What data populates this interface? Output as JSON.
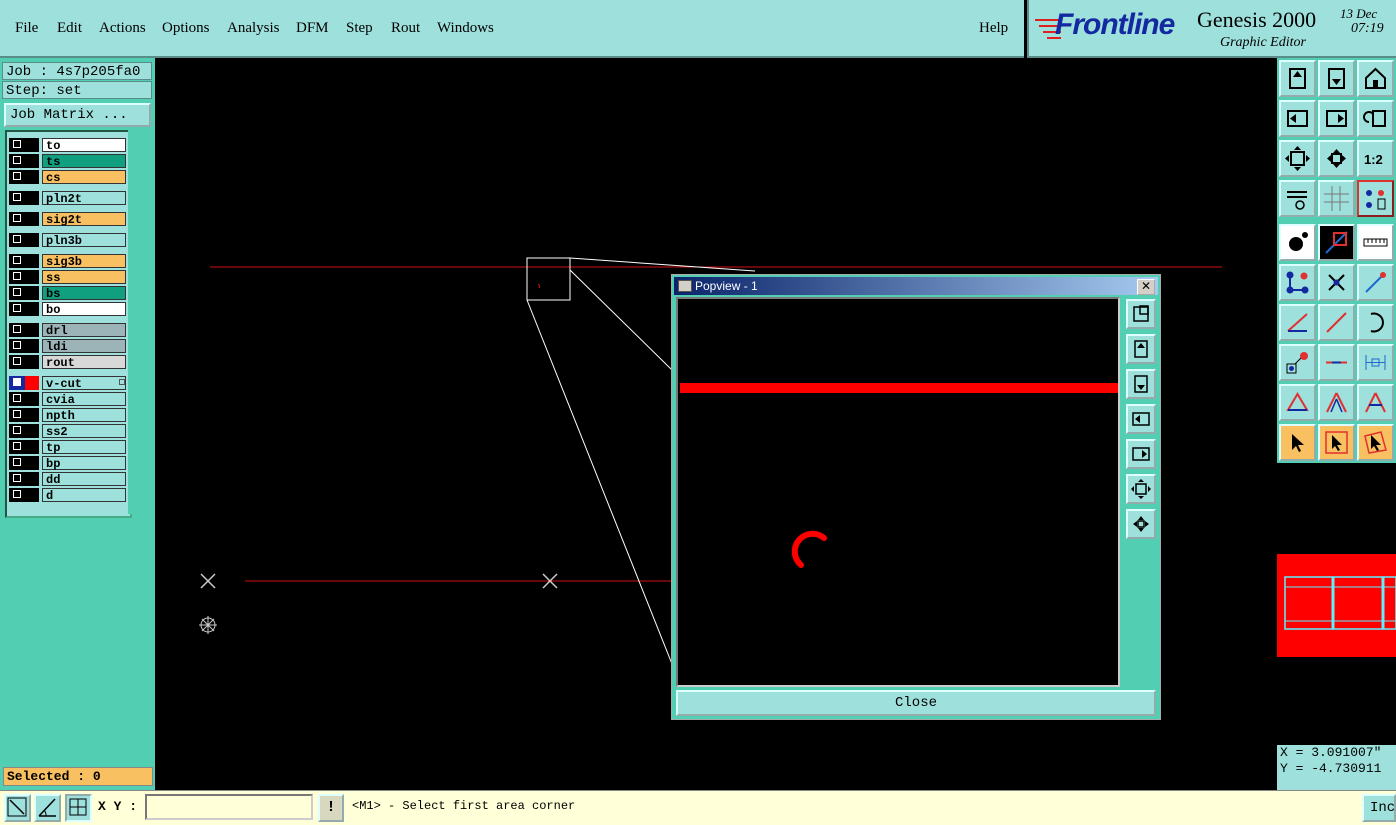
{
  "menu": {
    "items": [
      "File",
      "Edit",
      "Actions",
      "Options",
      "Analysis",
      "DFM",
      "Step",
      "Rout",
      "Windows"
    ],
    "help": "Help"
  },
  "brand": {
    "logo": "Frontline",
    "product": "Genesis 2000",
    "subtitle": "Graphic Editor",
    "date": "13 Dec",
    "time": "07:19"
  },
  "job": {
    "job_text": "Job : 4s7p205fa0",
    "step_text": "Step: set",
    "matrix_button": "Job Matrix ..."
  },
  "layers": [
    {
      "name": "to",
      "color": "#ffffff"
    },
    {
      "name": "ts",
      "color": "#10a080"
    },
    {
      "name": "cs",
      "color": "#f8c060"
    },
    {
      "name": "pln2t",
      "color": "#9ee0dc"
    },
    {
      "name": "sig2t",
      "color": "#f8c060"
    },
    {
      "name": "pln3b",
      "color": "#9ee0dc"
    },
    {
      "name": "sig3b",
      "color": "#f8c060"
    },
    {
      "name": "ss",
      "color": "#f8c060"
    },
    {
      "name": "bs",
      "color": "#10a080"
    },
    {
      "name": "bo",
      "color": "#ffffff"
    },
    {
      "name": "drl",
      "color": "#9cb4b8"
    },
    {
      "name": "ldi",
      "color": "#9cb4b8"
    },
    {
      "name": "rout",
      "color": "#d8d8d8"
    },
    {
      "name": "v-cut",
      "color": "#9ee0dc",
      "active": true
    },
    {
      "name": "cvia",
      "color": "#9ee0dc"
    },
    {
      "name": "npth",
      "color": "#9ee0dc"
    },
    {
      "name": "ss2",
      "color": "#9ee0dc"
    },
    {
      "name": "tp",
      "color": "#9ee0dc"
    },
    {
      "name": "bp",
      "color": "#9ee0dc"
    },
    {
      "name": "dd",
      "color": "#9ee0dc"
    },
    {
      "name": "d",
      "color": "#9ee0dc"
    }
  ],
  "selected_text": "Selected : 0",
  "popview": {
    "title": "Popview - 1",
    "close_label": "Close",
    "close_x": "✕"
  },
  "coords": {
    "x_text": "X = 3.091007\"",
    "y_text": "Y = -4.730911"
  },
  "statusbar": {
    "xy_label": "X Y :",
    "xy_value": "",
    "warn_symbol": "!",
    "message": "<M1> - Select first area corner",
    "right_button": "Inc"
  },
  "colors": {
    "teal": "#52cfb2",
    "light_teal": "#9ee0dc",
    "yellow": "#f8c060",
    "red": "#ff0000"
  }
}
